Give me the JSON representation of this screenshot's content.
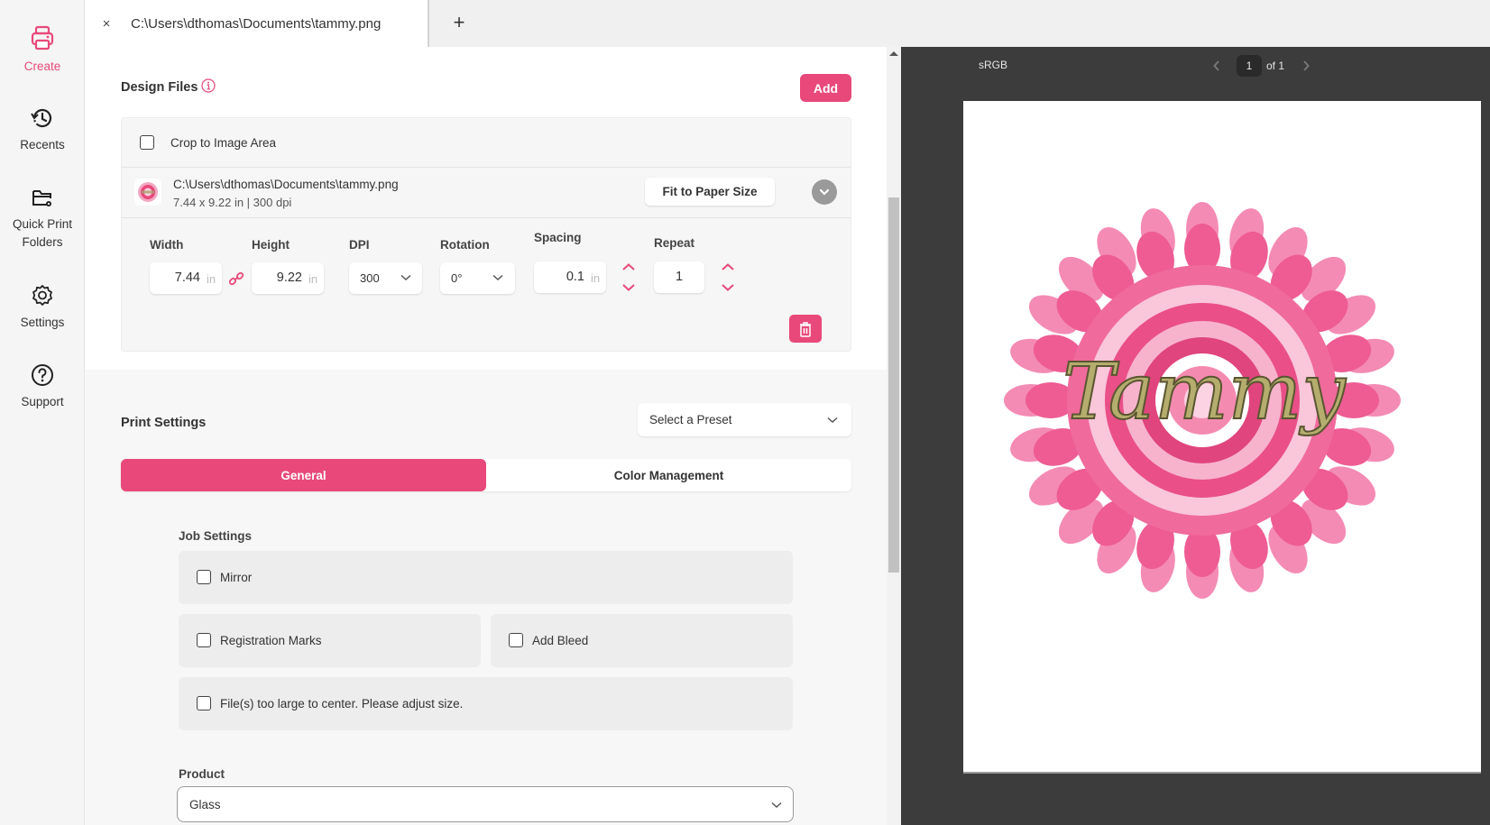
{
  "nav": {
    "items": [
      {
        "label": "Create",
        "icon": "printer-icon",
        "active": true
      },
      {
        "label": "Recents",
        "icon": "history-icon",
        "active": false
      },
      {
        "label": "Quick Print Folders",
        "icon": "folder-gear-icon",
        "active": false
      },
      {
        "label": "Settings",
        "icon": "gear-icon",
        "active": false
      },
      {
        "label": "Support",
        "icon": "help-circle-icon",
        "active": false
      }
    ]
  },
  "tabs": {
    "items": [
      {
        "close": "×",
        "title": "C:\\Users\\dthomas\\Documents\\tammy.png"
      }
    ],
    "add_label": "+"
  },
  "design_files": {
    "title": "Design Files",
    "add_label": "Add",
    "crop_label": "Crop to Image Area",
    "crop_checked": false,
    "file": {
      "path": "C:\\Users\\dthomas\\Documents\\tammy.png",
      "meta": "7.44 x 9.22 in | 300 dpi",
      "fit_label": "Fit to Paper Size"
    },
    "fields": {
      "width_label": "Width",
      "width_value": "7.44",
      "height_label": "Height",
      "height_value": "9.22",
      "unit": "in",
      "dpi_label": "DPI",
      "dpi_value": "300",
      "rotation_label": "Rotation",
      "rotation_value": "0°",
      "spacing_label": "Spacing",
      "spacing_value": "0.1",
      "repeat_label": "Repeat",
      "repeat_value": "1"
    }
  },
  "print_settings": {
    "title": "Print Settings",
    "preset_placeholder": "Select a Preset",
    "tabs": [
      {
        "label": "General",
        "active": true
      },
      {
        "label": "Color Management",
        "active": false
      }
    ],
    "job_settings_title": "Job Settings",
    "options": {
      "mirror": {
        "label": "Mirror",
        "checked": false
      },
      "registration_marks": {
        "label": "Registration Marks",
        "checked": false
      },
      "add_bleed": {
        "label": "Add Bleed",
        "checked": false
      },
      "too_large": {
        "label": "File(s) too large to center. Please adjust size.",
        "checked": false
      }
    },
    "product_label": "Product",
    "product_value": "Glass"
  },
  "preview": {
    "color_profile": "sRGB",
    "page_current": "1",
    "page_of": "of",
    "page_total": "1",
    "artwork_text": "Tammy"
  },
  "colors": {
    "accent": "#e8497a",
    "preview_bg": "#3c3c3c"
  }
}
